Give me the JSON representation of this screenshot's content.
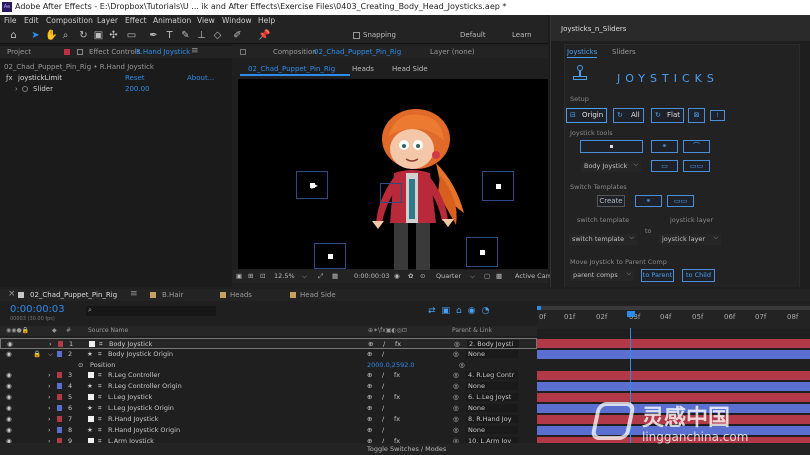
{
  "window": {
    "title": "Adobe After Effects - E:\\Dropbox\\Tutorials\\U ... ik and After Effects\\Exercise Files\\0403_Creating_Body_Head_Joysticks.aep *"
  },
  "menu": [
    "File",
    "Edit",
    "Composition",
    "Layer",
    "Effect",
    "Animation",
    "View",
    "Window",
    "Help"
  ],
  "toolbar": {
    "snapping": "Snapping",
    "workspace_default": "Default",
    "workspace_learn": "Learn"
  },
  "project": {
    "tab": "Project",
    "effect_controls": "Effect Controls",
    "effect_target": "R.Hand Joystick",
    "crumb": "02_Chad_Puppet_Pin_Rig • R.Hand Joystick",
    "effect_name": "joystickLimit",
    "reset": "Reset",
    "about": "About...",
    "slider_label": "Slider",
    "slider_value": "200.00"
  },
  "composition": {
    "tab_prefix": "Composition",
    "tab_name": "02_Chad_Puppet_Pin_Rig",
    "layer_tab": "Layer (none)",
    "subtabs": [
      "02_Chad_Puppet_Pin_Rig",
      "Heads",
      "Head Side"
    ],
    "zoom": "12.5%",
    "timecode": "0:00:00:03",
    "quality": "Quarter",
    "camera": "Active Cam"
  },
  "joysticks_panel": {
    "title": "Joysticks_n_Sliders",
    "tabs": [
      "Joysticks",
      "Sliders"
    ],
    "logo_text": "JOYSTICKS",
    "setup_label": "Setup",
    "setup_buttons": [
      "Origin",
      "All",
      "Flat"
    ],
    "setup_small": "!",
    "tools_label": "Joystick tools",
    "tools_dropdown": "Body Joystick",
    "switch_label": "Switch Templates",
    "create_button": "Create",
    "switch_template_label": "switch template",
    "joystick_layer_label": "joystick layer",
    "switch_template_dropdown": "switch template",
    "to_label": "to",
    "joystick_layer_dropdown": "joystick layer",
    "move_label": "Move Joystick to Parent Comp",
    "parent_dropdown": "parent comps",
    "to_parent": "to Parent",
    "to_child": "to Child"
  },
  "timeline": {
    "tabs": [
      "02_Chad_Puppet_Pin_Rig",
      "B.Hair",
      "Heads",
      "Head Side"
    ],
    "timecode": "0:00:00:03",
    "frames_text": "00003 (30.00 fps)",
    "col_source": "Source Name",
    "col_parent": "Parent & Link",
    "ruler": [
      "0f",
      "01f",
      "02f",
      "03f",
      "04f",
      "05f",
      "06f",
      "07f",
      "08f"
    ],
    "toggle_label": "Toggle Switches / Modes",
    "layers": [
      {
        "num": "1",
        "name": "Body Joystick",
        "parent": "2. Body Joysti",
        "color": "#b23a48",
        "type": "layer"
      },
      {
        "num": "2",
        "name": "Body Joystick Origin",
        "parent": "None",
        "color": "#5a6fd0",
        "type": "layer"
      },
      {
        "num": "",
        "name": "Position",
        "value": "2000.0,2592.0",
        "type": "prop"
      },
      {
        "num": "3",
        "name": "R.Leg Controller",
        "parent": "4. R.Leg Contr",
        "color": "#b23a48",
        "type": "layer"
      },
      {
        "num": "4",
        "name": "R.Leg Controller Origin",
        "parent": "None",
        "color": "#5a6fd0",
        "type": "layer"
      },
      {
        "num": "5",
        "name": "L.Leg Joystick",
        "parent": "6. L.Leg Joyst",
        "color": "#b23a48",
        "type": "layer"
      },
      {
        "num": "6",
        "name": "L.Leg Joystick Origin",
        "parent": "None",
        "color": "#5a6fd0",
        "type": "layer"
      },
      {
        "num": "7",
        "name": "R.Hand Joystick",
        "parent": "8. R.Hand Joy",
        "color": "#b23a48",
        "type": "layer"
      },
      {
        "num": "8",
        "name": "R.Hand Joystick Origin",
        "parent": "None",
        "color": "#5a6fd0",
        "type": "layer"
      },
      {
        "num": "9",
        "name": "L.Arm Joystick",
        "parent": "10. L.Arm Joy",
        "color": "#b23a48",
        "type": "layer"
      }
    ]
  },
  "watermark": {
    "brand": "灵感中国",
    "url": "lingganchina.com"
  },
  "colors": {
    "accent": "#2d8ceb",
    "red_layer": "#b23a48",
    "blue_layer": "#5a6fd0"
  }
}
